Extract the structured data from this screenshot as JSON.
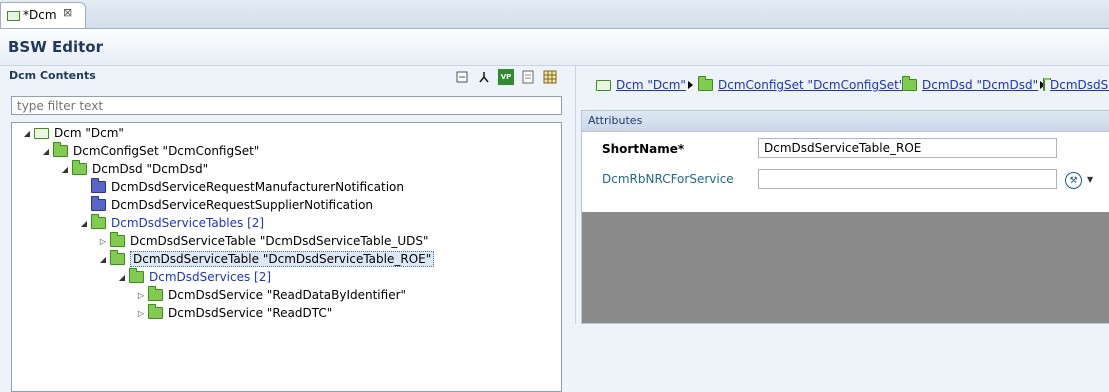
{
  "tab": {
    "title": "*Dcm",
    "close": "⊠"
  },
  "editor": {
    "title": "BSW Editor"
  },
  "left": {
    "title": "Dcm Contents",
    "filter_placeholder": "type filter text",
    "toolbar": [
      {
        "icon": "collapse-all-icon"
      },
      {
        "icon": "fork-icon"
      },
      {
        "icon": "vp-res-icon",
        "text": "VP"
      },
      {
        "icon": "document-icon"
      },
      {
        "icon": "grid-icon"
      }
    ],
    "tree": [
      {
        "label": "Dcm \"Dcm\"",
        "twisty": "◢",
        "icon": "module",
        "level": 0
      },
      {
        "label": "DcmConfigSet \"DcmConfigSet\"",
        "twisty": "◢",
        "icon": "folder",
        "level": 1
      },
      {
        "label": "DcmDsd \"DcmDsd\"",
        "twisty": "◢",
        "icon": "folder",
        "level": 2
      },
      {
        "label": "DcmDsdServiceRequestManufacturerNotification",
        "twisty": "",
        "icon": "blue",
        "level": 3
      },
      {
        "label": "DcmDsdServiceRequestSupplierNotification",
        "twisty": "",
        "icon": "blue",
        "level": 3
      },
      {
        "label": "DcmDsdServiceTables [2]",
        "twisty": "◢",
        "icon": "folder",
        "level": 3,
        "link": true
      },
      {
        "label": "DcmDsdServiceTable \"DcmDsdServiceTable_UDS\"",
        "twisty": "▷",
        "icon": "folder",
        "level": 4
      },
      {
        "label": "DcmDsdServiceTable \"DcmDsdServiceTable_ROE\"",
        "twisty": "◢",
        "icon": "folder",
        "level": 4,
        "selected": true
      },
      {
        "label": "DcmDsdServices [2]",
        "twisty": "◢",
        "icon": "folder",
        "level": 5,
        "link": true
      },
      {
        "label": "DcmDsdService \"ReadDataByIdentifier\"",
        "twisty": "▷",
        "icon": "folder",
        "level": 6
      },
      {
        "label": "DcmDsdService \"ReadDTC\"",
        "twisty": "▷",
        "icon": "folder",
        "level": 6
      }
    ]
  },
  "breadcrumb": [
    {
      "label": "Dcm \"Dcm\"",
      "icon": "module"
    },
    {
      "label": "DcmConfigSet \"DcmConfigSet\"",
      "icon": "folder"
    },
    {
      "label": "DcmDsd \"DcmDsd\"",
      "icon": "folder"
    },
    {
      "label": "DcmDsdServiceTables",
      "icon": "folder"
    }
  ],
  "attributes": {
    "title": "Attributes",
    "short_name_label": "ShortName*",
    "short_name_value": "DcmDsdServiceTable_ROE",
    "nrc_label": "DcmRbNRCForService",
    "nrc_value": "",
    "nrc_dropdown": "▼",
    "nrc_control": "⚒"
  }
}
